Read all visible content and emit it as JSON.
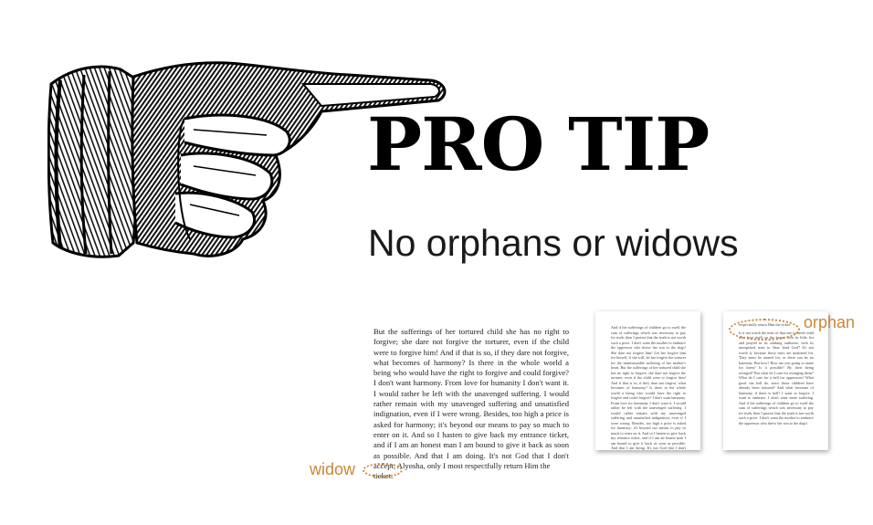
{
  "headline": "PRO TIP",
  "subheadline": "No orphans or widows",
  "passage": {
    "body": "But the sufferings of her tortured child she has no right to forgive; she dare not forgive the torturer, even if the child were to forgive him! And if that is so, if they dare not forgive, what becomes of harmony? Is there in the whole world a being who would have the right to forgive and could forgive? I don't want harmony. From love for humanity I don't want it. I would rather be left with the unavenged suffering. I would rather remain with my unavenged suffering and unsatisfied indignation, even if I were wrong. Besides, too high a price is asked for harmony; it's beyond our means to pay so much to enter on it. And so I hasten to give back my entrance ticket, and if I am an honest man I am bound to give it back as soon as possible. And that I am doing. It's not God that I don't accept, Alyosha, only I most respectfully return Him the",
    "widow_line": "ticket."
  },
  "widow_label": "widow",
  "orphan_label": "orphan",
  "page_left": {
    "text": "And if the sufferings of children go to swell the sum of sufferings which was necessary to pay for truth, then I protest that the truth is not worth such a price. I don't want the mother to embrace the oppressor who threw her son to the dogs! She dare not forgive him! Let her forgive him for herself, if she will, let her forgive the torturer for the immeasurable suffering of her mother's heart. But the sufferings of her tortured child she has no right to forgive; she dare not forgive the torturer, even if the child were to forgive him! And if that is so, if they dare not forgive, what becomes of harmony? Is there in the whole world a being who would have the right to forgive and could forgive? I don't want harmony. From love for humanity I don't want it. I would rather be left with the unavenged suffering. I would rather remain with my unavenged suffering and unsatisfied indignation, even if I were wrong. Besides, too high a price is asked for harmony; it's beyond our means to pay so much to enter on it. And so I hasten to give back my entrance ticket, and if I am an honest man I am bound to give it back as soon as possible. And that I am doing. It's not God that I don't accept, Alyosha, only I most"
  },
  "page_right": {
    "orphan_line": "respectfully return Him the ticket.",
    "text": "Is it not worth the tears of that one tortured child who beat itself on the breast with its little fist and prayed in its stinking outhouse, with its unexpiated tears to 'dear, kind God'! It's not worth it, because those tears are unatoned for. They must be atoned for, or there can be no harmony. But how? How are you going to atone for them? Is it possible? By their being avenged? But what do I care for avenging them? What do I care for a hell for oppressors? What good can hell do, since those children have already been tortured? And what becomes of harmony, if there is hell? I want to forgive. I want to embrace. I don't want more suffering. And if the sufferings of children go to swell the sum of sufferings which was necessary to pay for truth, then I protest that the truth is not worth such a price. I don't want the mother to embrace the oppressor who threw her son to the dogs!"
  }
}
